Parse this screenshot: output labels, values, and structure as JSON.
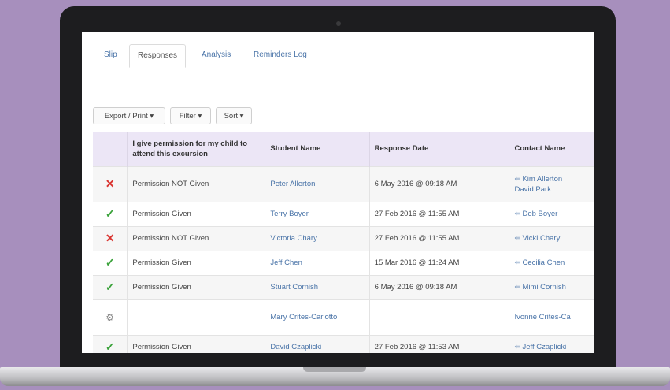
{
  "tabs": [
    {
      "label": "Slip",
      "active": false
    },
    {
      "label": "Responses",
      "active": true
    },
    {
      "label": "Analysis",
      "active": false
    },
    {
      "label": "Reminders Log",
      "active": false
    }
  ],
  "toolbar": {
    "export_label": "Export / Print ▾",
    "filter_label": "Filter ▾",
    "sort_label": "Sort ▾"
  },
  "table": {
    "headers": {
      "permission": "I give permission for my child to attend this excursion",
      "student": "Student Name",
      "date": "Response Date",
      "contact": "Contact Name"
    },
    "rows": [
      {
        "status": "not-given",
        "status_icon": "✕",
        "permission": "Permission NOT Given",
        "student": "Peter Allerton",
        "date": "6 May 2016 @ 09:18 AM",
        "contacts": [
          "Kim Allerton",
          "David Park"
        ]
      },
      {
        "status": "given",
        "status_icon": "✓",
        "permission": "Permission Given",
        "student": "Terry Boyer",
        "date": "27 Feb 2016 @ 11:55 AM",
        "contacts": [
          "Deb Boyer"
        ]
      },
      {
        "status": "not-given",
        "status_icon": "✕",
        "permission": "Permission NOT Given",
        "student": "Victoria Chary",
        "date": "27 Feb 2016 @ 11:55 AM",
        "contacts": [
          "Vicki Chary"
        ]
      },
      {
        "status": "given",
        "status_icon": "✓",
        "permission": "Permission Given",
        "student": "Jeff Chen",
        "date": "15 Mar 2016 @ 11:24 AM",
        "contacts": [
          "Cecilia Chen"
        ]
      },
      {
        "status": "given",
        "status_icon": "✓",
        "permission": "Permission Given",
        "student": "Stuart Cornish",
        "date": "6 May 2016 @ 09:18 AM",
        "contacts": [
          "Mimi Cornish"
        ]
      },
      {
        "status": "pending",
        "status_icon": "⚙",
        "permission": "",
        "student": "Mary Crites-Cariotto",
        "date": "",
        "contacts": [
          "Ivonne Crites-Ca"
        ]
      },
      {
        "status": "given",
        "status_icon": "✓",
        "permission": "Permission Given",
        "student": "David Czaplicki",
        "date": "27 Feb 2016 @ 11:53 AM",
        "contacts": [
          "Jeff Czaplicki"
        ]
      }
    ]
  },
  "colors": {
    "background": "#a78fbd",
    "header_row": "#ece6f6",
    "link": "#4a74a8",
    "status_not_given": "#d9332f",
    "status_given": "#3aa23a"
  }
}
